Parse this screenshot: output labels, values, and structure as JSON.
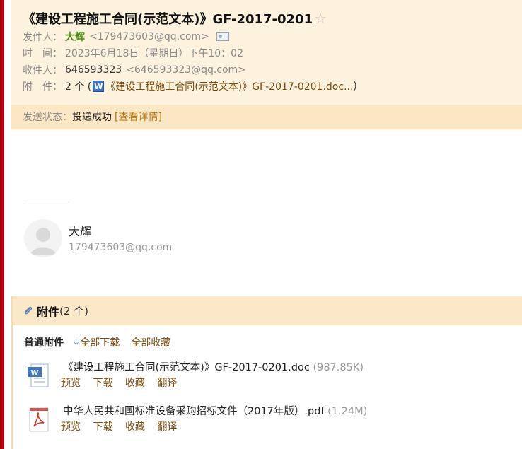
{
  "header": {
    "subject": "《建设工程施工合同(示范文本)》GF-2017-0201",
    "sender_label": "发件人：",
    "sender_name": "大辉",
    "sender_email": "<179473603@qq.com>",
    "time_label": "时　间：",
    "time_value": "2023年6月18日（星期日）下午10：02",
    "recipient_label": "收件人：",
    "recipient_name": "646593323",
    "recipient_email": "<646593323@qq.com>",
    "attach_label": "附　件：",
    "attach_count": "2 个 (",
    "attach_preview": "《建设工程施工合同(示范文本)》GF-2017-0201.doc...",
    "attach_close": ")"
  },
  "status": {
    "label": "发送状态：",
    "value": "投递成功",
    "detail": "[查看详情]"
  },
  "signature": {
    "name": "大辉",
    "email": "179473603@qq.com"
  },
  "attachments": {
    "title": "附件",
    "count": "(2 个)",
    "type_label": "普通附件",
    "download_all": "全部下载",
    "save_all": "全部收藏",
    "files": [
      {
        "name": "《建设工程施工合同(示范文本)》GF-2017-0201.doc",
        "size": "(987.85K)",
        "icon": "word-icon",
        "actions": [
          "预览",
          "下载",
          "收藏",
          "翻译"
        ]
      },
      {
        "name": "中华人民共和国标准设备采购招标文件（2017年版）.pdf",
        "size": "(1.24M)",
        "icon": "pdf-icon",
        "actions": [
          "预览",
          "下载",
          "收藏",
          "翻译"
        ]
      }
    ]
  },
  "colors": {
    "header_bg": "#fdf2de",
    "status_bg": "#fce7c4",
    "link": "#7a4b0a",
    "sender": "#4b8a10",
    "left_bar": "#b00010"
  }
}
